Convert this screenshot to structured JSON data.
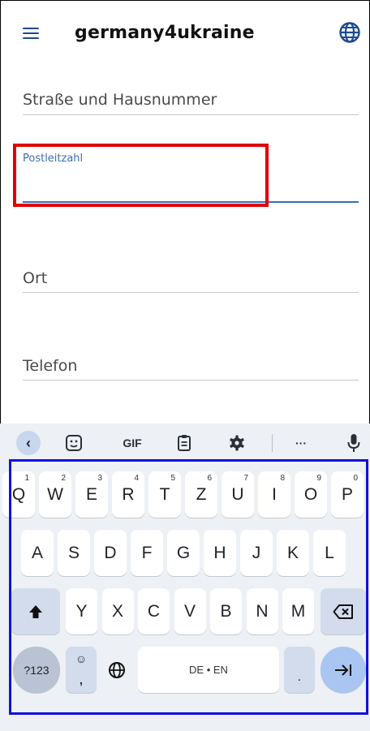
{
  "app": {
    "title": "germany4ukraine",
    "menu_icon": "hamburger-menu-icon",
    "language_icon": "globe-icon"
  },
  "form": {
    "street_label": "Straße und Hausnummer",
    "postal_label": "Postleitzahl",
    "city_label": "Ort",
    "phone_label": "Telefon"
  },
  "keyboard": {
    "toolbar": {
      "back": "‹",
      "gif": "GIF",
      "more": "···"
    },
    "row1": [
      {
        "key": "Q",
        "hint": "1"
      },
      {
        "key": "W",
        "hint": "2"
      },
      {
        "key": "E",
        "hint": "3"
      },
      {
        "key": "R",
        "hint": "4"
      },
      {
        "key": "T",
        "hint": "5"
      },
      {
        "key": "Z",
        "hint": "6"
      },
      {
        "key": "U",
        "hint": "7"
      },
      {
        "key": "I",
        "hint": "8"
      },
      {
        "key": "O",
        "hint": "9"
      },
      {
        "key": "P",
        "hint": "0"
      }
    ],
    "row2": [
      "A",
      "S",
      "D",
      "F",
      "G",
      "H",
      "J",
      "K",
      "L"
    ],
    "row3": [
      "Y",
      "X",
      "C",
      "V",
      "B",
      "N",
      "M"
    ],
    "symbols_label": "?123",
    "emoji_top": "☺",
    "emoji_bottom": ",",
    "space_label": "DE • EN",
    "period": ".",
    "colors": {
      "background": "#edf0f4",
      "key": "#ffffff",
      "modifier": "#d3dced",
      "enter": "#a9c6f2"
    }
  },
  "highlights": {
    "red_box_color": "#e00000",
    "blue_box_color": "#1010e0"
  }
}
